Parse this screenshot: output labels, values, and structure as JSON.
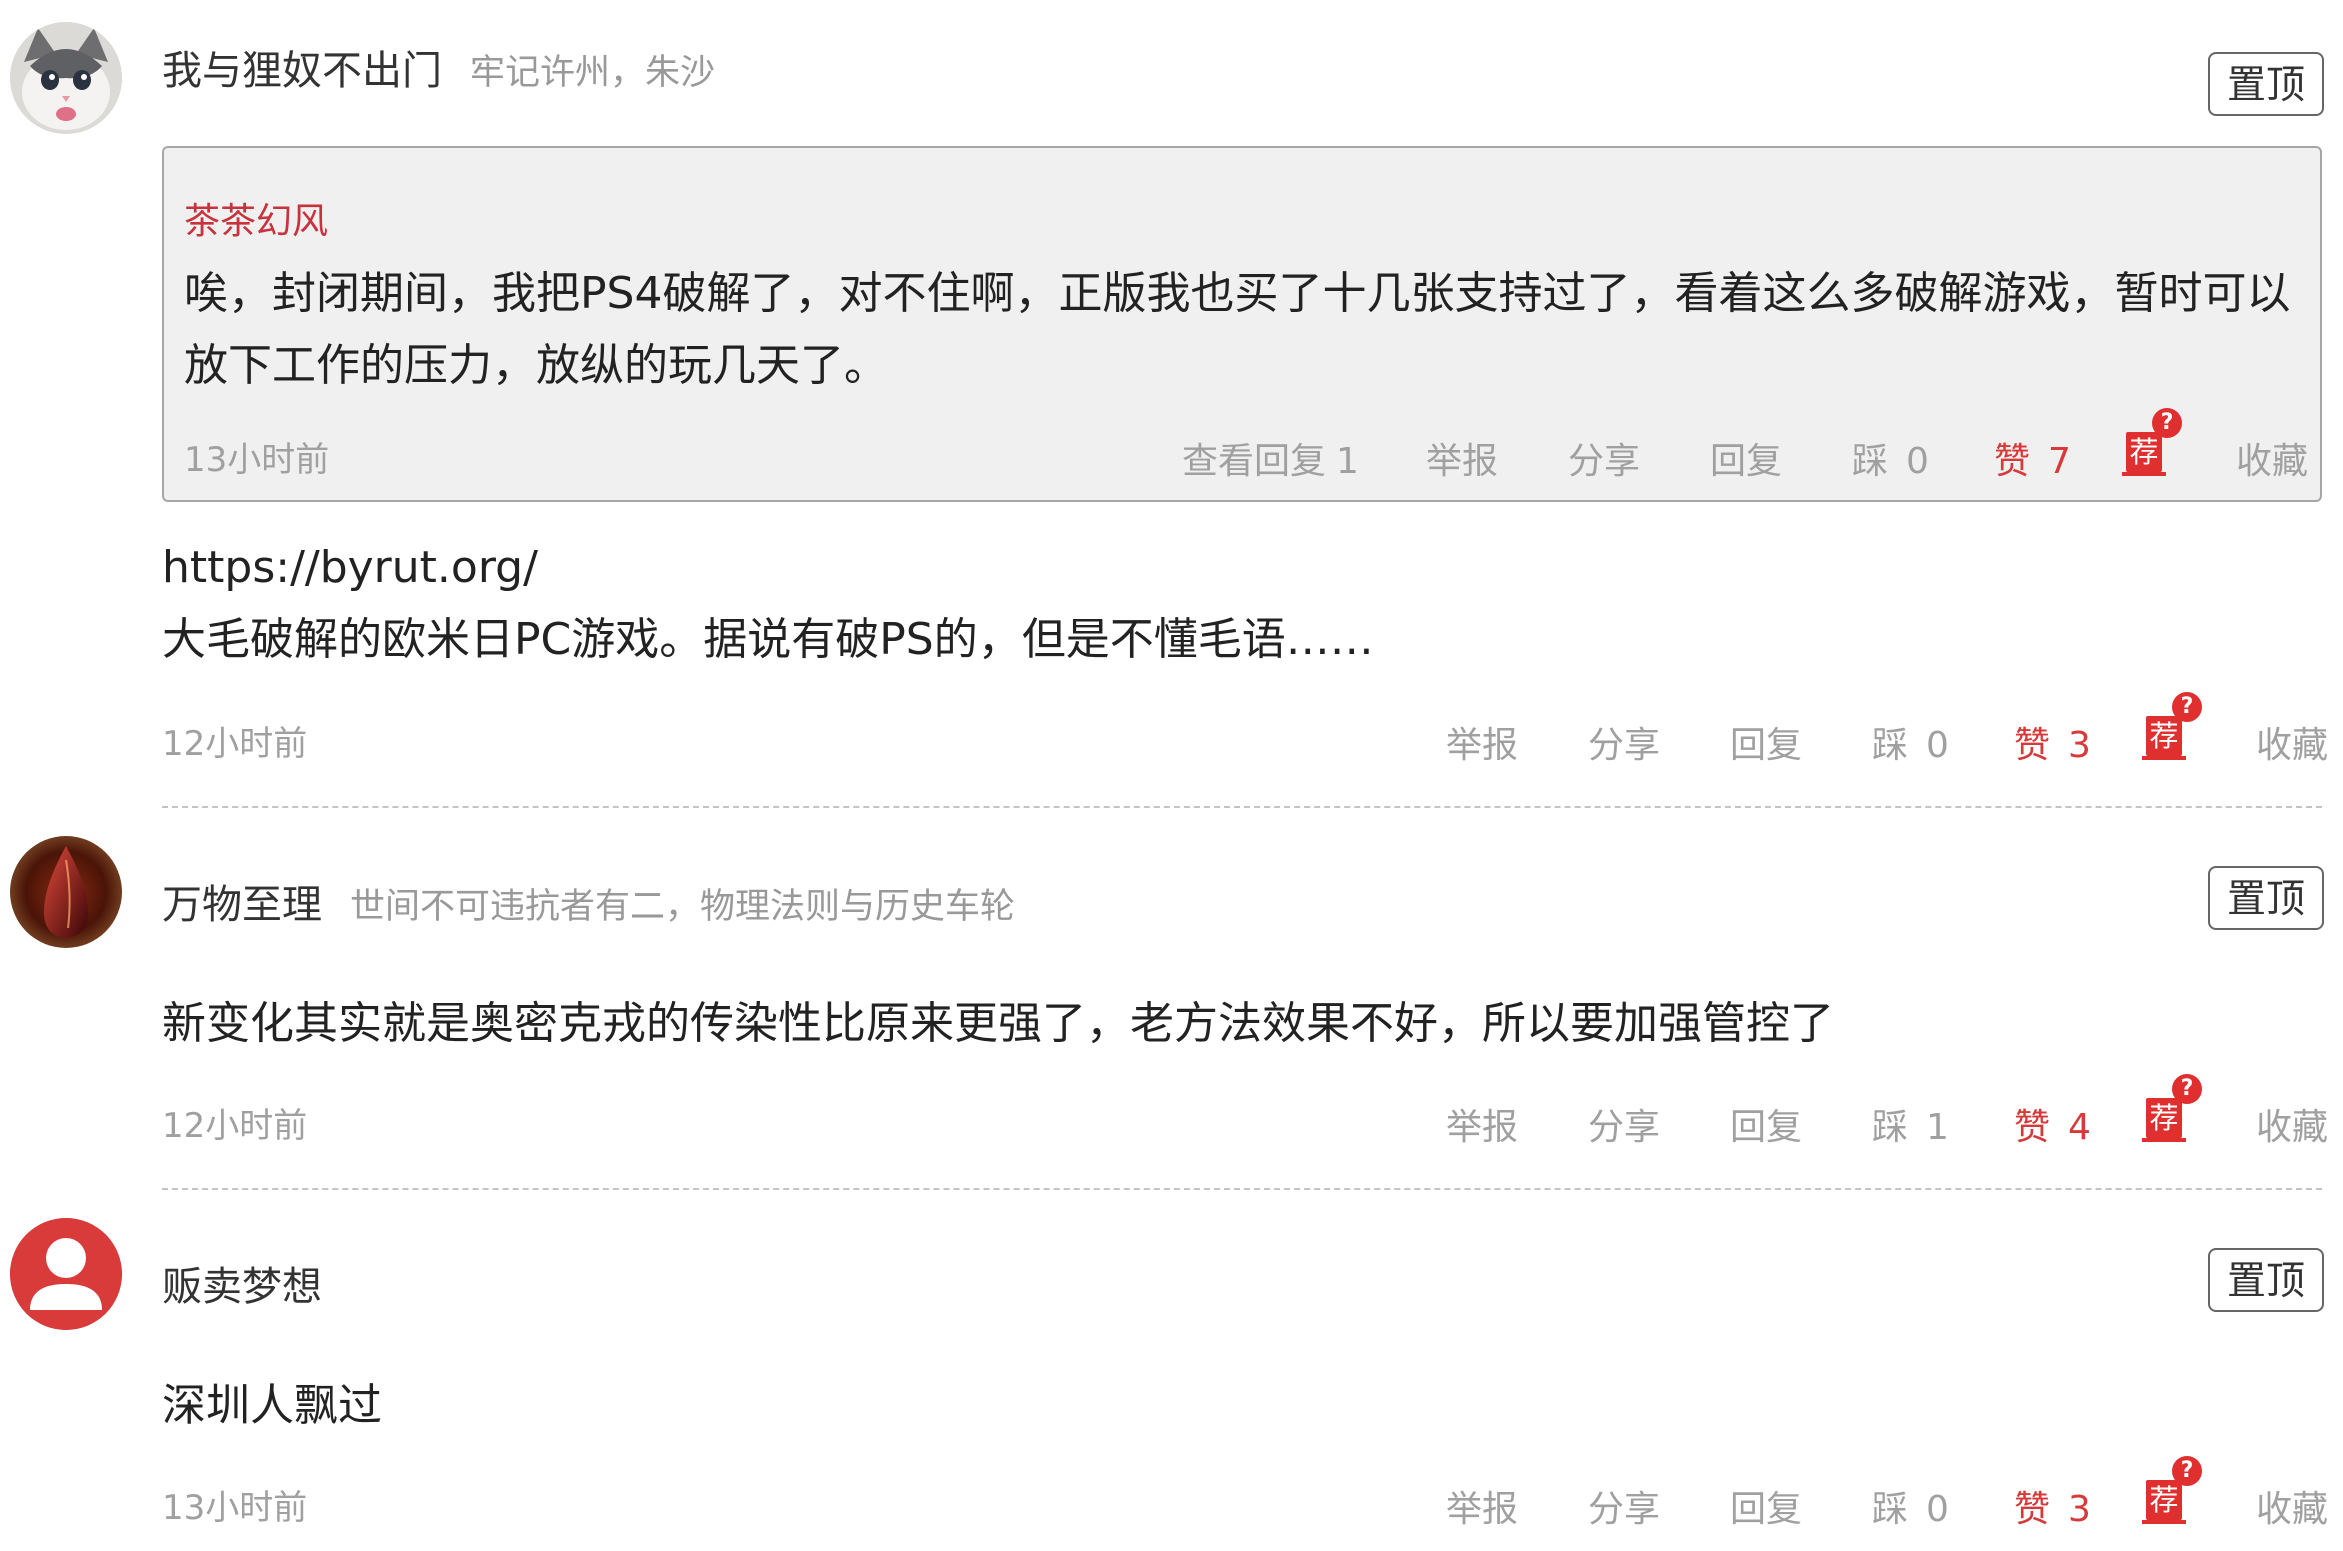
{
  "comments": [
    {
      "username": "我与狸奴不出门",
      "signature": "牢记许州，朱沙",
      "avatar_icon": "cat-avatar-icon",
      "pin_label": "置顶",
      "quote": {
        "author": "茶茶幻风",
        "text": "唉，封闭期间，我把PS4破解了，对不住啊，正版我也买了十几张支持过了，看着这么多破解游戏，暂时可以放下工作的压力，放纵的玩几天了。",
        "time": "13小时前",
        "view_replies": "查看回复",
        "view_replies_count": "1",
        "report": "举报",
        "share": "分享",
        "reply": "回复",
        "dislike": "踩",
        "dislike_count": "0",
        "like": "赞",
        "like_count": "7",
        "recommend": "荐",
        "favorite": "收藏"
      },
      "text_lines": [
        "https://byrut.org/",
        "大毛破解的欧米日PC游戏。据说有破PS的，但是不懂毛语……"
      ],
      "time": "12小时前",
      "report": "举报",
      "share": "分享",
      "reply": "回复",
      "dislike": "踩",
      "dislike_count": "0",
      "like": "赞",
      "like_count": "3",
      "recommend": "荐",
      "favorite": "收藏"
    },
    {
      "username": "万物至理",
      "signature": "世间不可违抗者有二，物理法则与历史车轮",
      "avatar_icon": "blood-drop-avatar-icon",
      "pin_label": "置顶",
      "text_lines": [
        "新变化其实就是奥密克戎的传染性比原来更强了，老方法效果不好，所以要加强管控了"
      ],
      "time": "12小时前",
      "report": "举报",
      "share": "分享",
      "reply": "回复",
      "dislike": "踩",
      "dislike_count": "1",
      "like": "赞",
      "like_count": "4",
      "recommend": "荐",
      "favorite": "收藏"
    },
    {
      "username": "贩卖梦想",
      "signature": "",
      "avatar_icon": "default-user-avatar-icon",
      "pin_label": "置顶",
      "text_lines": [
        "深圳人飘过"
      ],
      "time": "13小时前",
      "report": "举报",
      "share": "分享",
      "reply": "回复",
      "dislike": "踩",
      "dislike_count": "0",
      "like": "赞",
      "like_count": "3",
      "recommend": "荐",
      "favorite": "收藏"
    }
  ],
  "colors": {
    "like": "#d63a3a",
    "quote_author": "#c8323c",
    "muted": "#a0a0a0",
    "avatar_default": "#d93a3a"
  }
}
